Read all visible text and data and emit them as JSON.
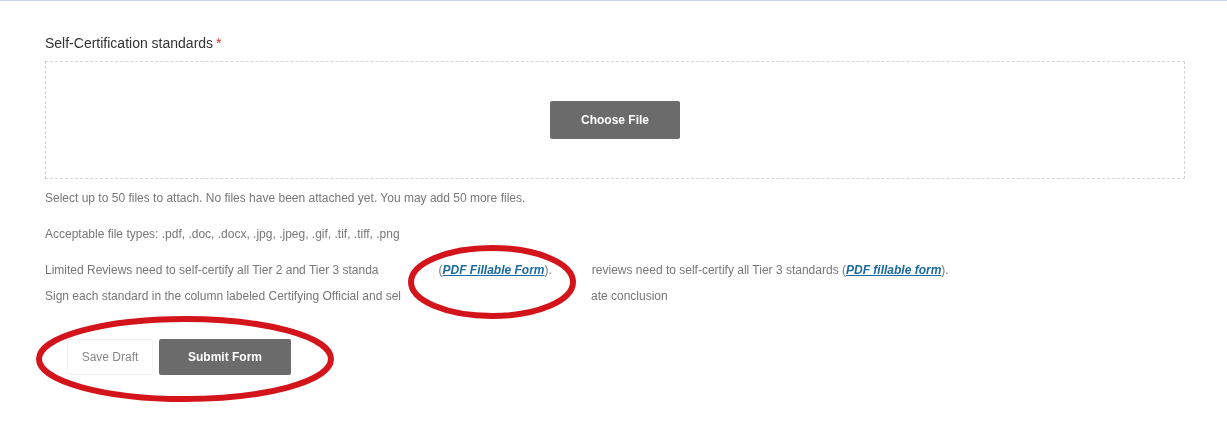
{
  "field": {
    "label": "Self-Certification standards",
    "required": true,
    "required_mark": "*"
  },
  "upload": {
    "button": "Choose File"
  },
  "help": {
    "limit": "Select up to 50 files to attach. No files have been attached yet. You may add 50 more files.",
    "types": "Acceptable file types: .pdf, .doc, .docx, .jpg, .jpeg, .gif, .tif, .tiff, .png",
    "line1_start": "Limited Reviews need to self-certify all Tier 2 and Tier 3 standa",
    "link1_open": "(",
    "link1": "PDF Fillable Form",
    "link1_close": ").",
    "line1_rest": "reviews need to self-certify all Tier 3 standards (",
    "link2": "PDF fillable form",
    "line1_end": ").",
    "line2_start": "Sign each standard in the column labeled Certifying Official and sel",
    "line2_end": "ate conclusion"
  },
  "actions": [
    {
      "label": "Save Draft",
      "kind": "secondary"
    },
    {
      "label": "Submit Form",
      "kind": "primary"
    }
  ]
}
